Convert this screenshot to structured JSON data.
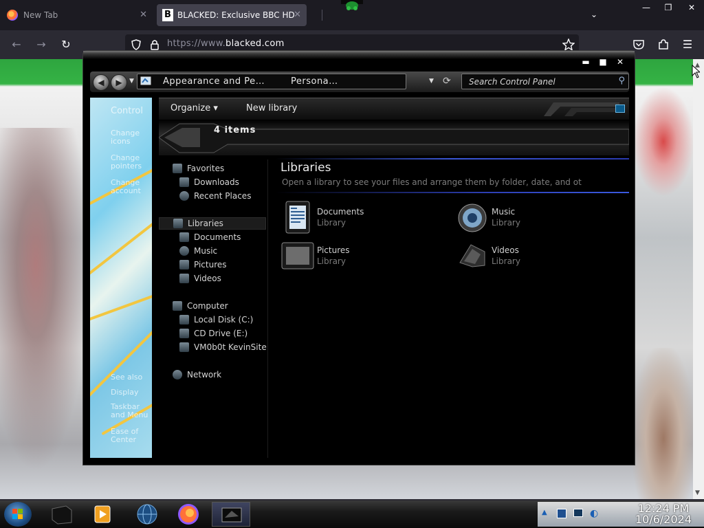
{
  "browser": {
    "tabs": [
      {
        "title": "New Tab",
        "active": false
      },
      {
        "title": "BLACKED: Exclusive BBC HD E",
        "active": true
      }
    ],
    "favicon_letter": "B",
    "url": {
      "scheme": "https://",
      "host_prefix": "www.",
      "domain": "blacked.com"
    }
  },
  "explorer": {
    "address": {
      "seg1": "Appearance and Pe…",
      "seg2": "Persona…"
    },
    "search_placeholder": "Search Control Panel",
    "left_panel": {
      "items": [
        "Control",
        "Change icons",
        "Change pointers",
        "Change account",
        "See also",
        "Display",
        "Taskbar and Menu",
        "Ease of Center"
      ]
    },
    "toolbar": {
      "organize": "Organize",
      "new_library": "New library"
    },
    "item_count": "4 items",
    "nav": {
      "favorites": "Favorites",
      "downloads": "Downloads",
      "recent": "Recent Places",
      "libraries": "Libraries",
      "documents": "Documents",
      "music": "Music",
      "pictures": "Pictures",
      "videos": "Videos",
      "computer": "Computer",
      "local_disk": "Local Disk (C:)",
      "cd_drive": "CD Drive (E:)",
      "share": "VM0b0t KevinSite",
      "network": "Network"
    },
    "content": {
      "title": "Libraries",
      "subtitle": "Open a library to see your files and arrange them by folder, date, and ot",
      "libraries": [
        {
          "name": "Documents",
          "type": "Library",
          "icon": "documents-icon"
        },
        {
          "name": "Music",
          "type": "Library",
          "icon": "music-icon"
        },
        {
          "name": "Pictures",
          "type": "Library",
          "icon": "pictures-icon"
        },
        {
          "name": "Videos",
          "type": "Library",
          "icon": "videos-icon"
        }
      ]
    }
  },
  "taskbar": {
    "time": "12:24 PM",
    "date": "10/6/2024"
  }
}
